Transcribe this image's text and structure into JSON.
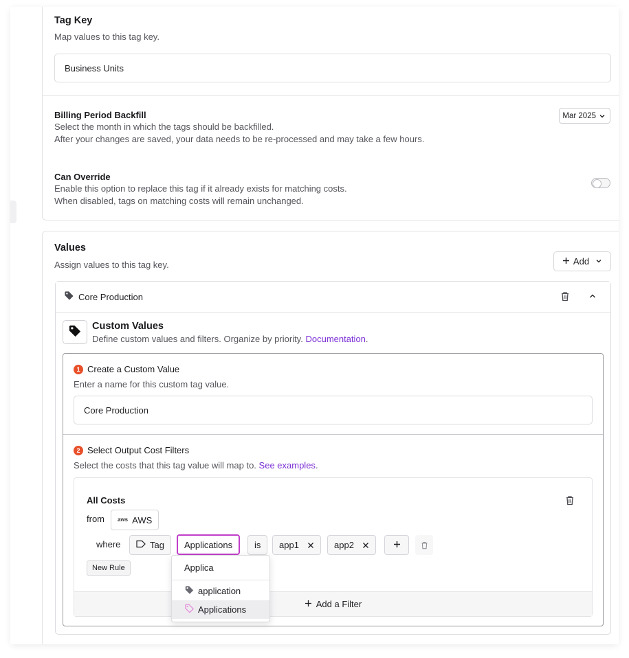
{
  "tag_key": {
    "title": "Tag Key",
    "description": "Map values to this tag key.",
    "value": "Business Units"
  },
  "billing_backfill": {
    "title": "Billing Period Backfill",
    "description_line1": "Select the month in which the tags should be backfilled.",
    "description_line2": "After your changes are saved, your data needs to be re-processed and may take a few hours.",
    "selected_month": "Mar 2025"
  },
  "can_override": {
    "title": "Can Override",
    "description_line1": "Enable this option to replace this tag if it already exists for matching costs.",
    "description_line2": "When disabled, tags on matching costs will remain unchanged.",
    "enabled": false
  },
  "values": {
    "title": "Values",
    "description": "Assign values to this tag key.",
    "add_label": "Add",
    "item": {
      "name": "Core Production",
      "custom_values": {
        "title": "Custom Values",
        "description": "Define custom values and filters. Organize by priority.",
        "doc_link": "Documentation",
        "doc_suffix": "."
      },
      "step1": {
        "number": "1",
        "title": "Create a Custom Value",
        "description": "Enter a name for this custom tag value.",
        "value": "Core Production"
      },
      "step2": {
        "number": "2",
        "title": "Select Output Cost Filters",
        "description": "Select the costs that this tag value will map to.",
        "examples_link": "See examples",
        "examples_suffix": "."
      },
      "filter": {
        "title": "All Costs",
        "from_label": "from",
        "provider_logo": "aws",
        "provider": "AWS",
        "where_label": "where",
        "dimension": "Tag",
        "tag_key": "Applications",
        "operator": "is",
        "values": [
          "app1",
          "app2"
        ],
        "new_rule_label": "New Rule",
        "add_filter_label": "Add a Filter"
      },
      "dropdown": {
        "search_value": "Applica",
        "options": [
          {
            "label": "application",
            "icon": "tag-icon",
            "color": "#6b6b73"
          },
          {
            "label": "Applications",
            "icon": "tag-icon",
            "color": "#e48ad8"
          }
        ],
        "highlighted": "Applications"
      }
    }
  },
  "colors": {
    "accent": "#7b2fd6",
    "step_badge": "#e8502a",
    "active_border": "#c13ec9"
  }
}
